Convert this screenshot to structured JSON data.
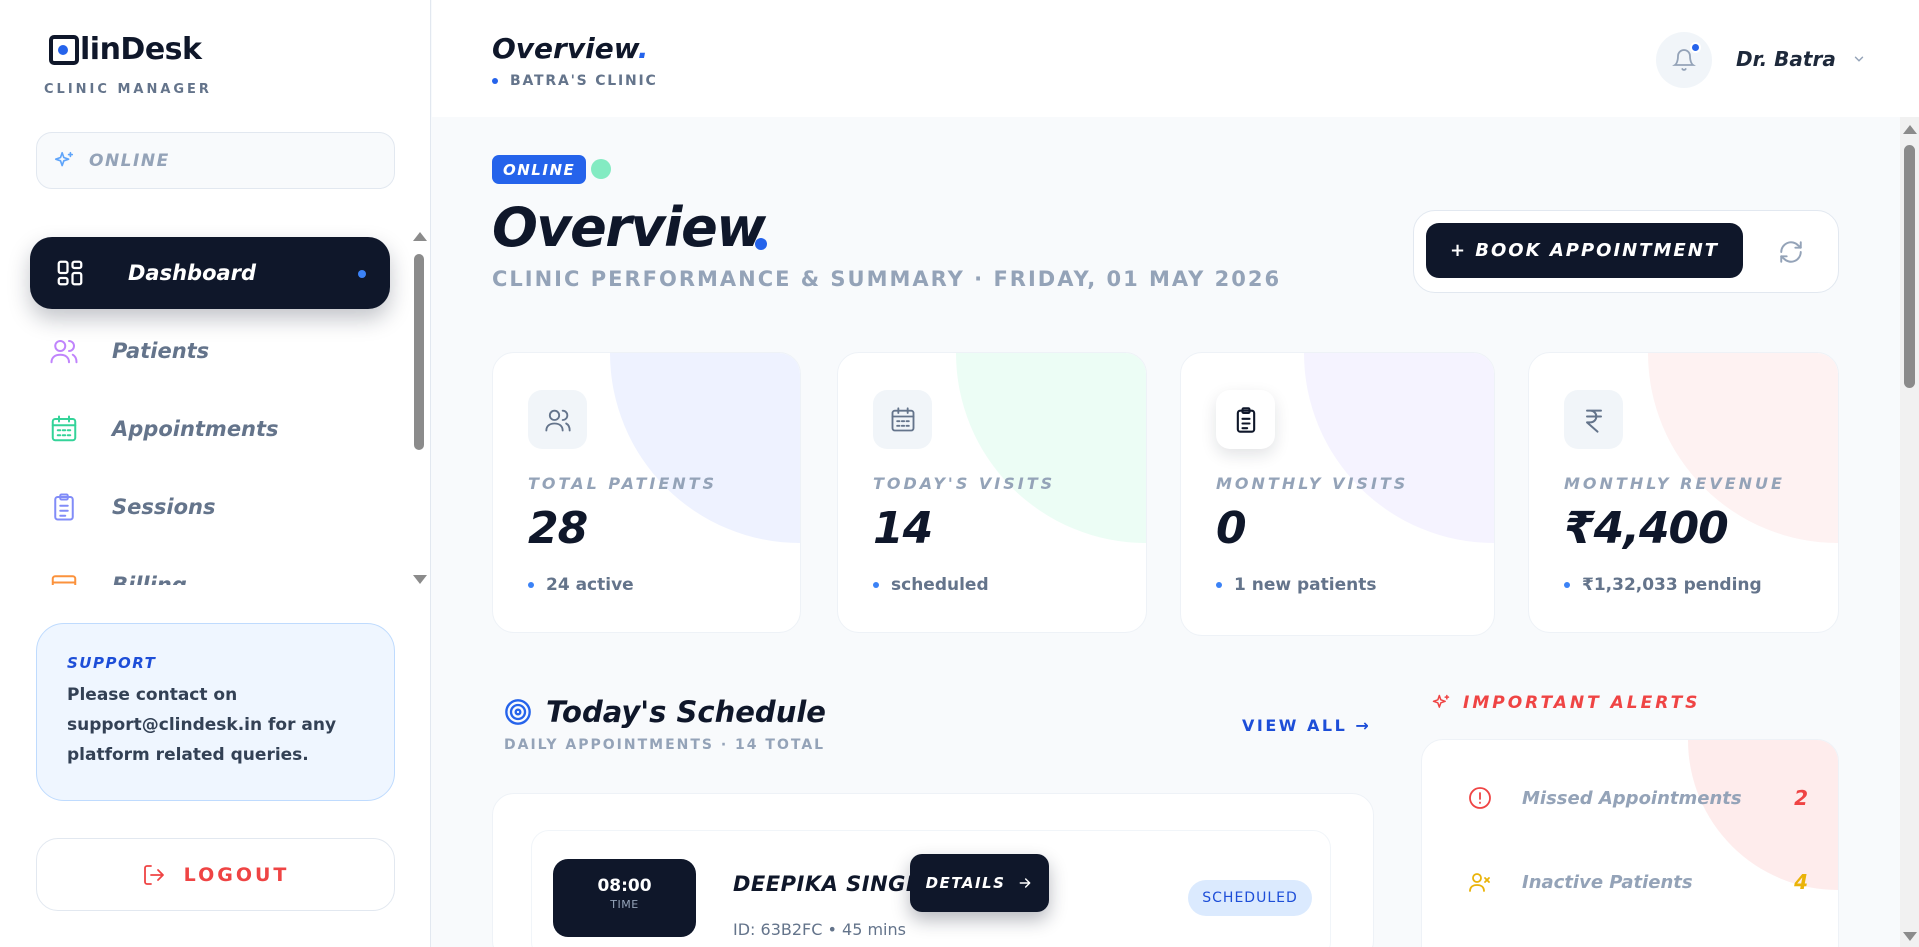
{
  "brand": {
    "lin": "linDesk",
    "sub": "CLINIC MANAGER"
  },
  "sidebar": {
    "status": "ONLINE",
    "items": [
      {
        "label": "Dashboard",
        "icon": "dashboard-icon",
        "active": true
      },
      {
        "label": "Patients",
        "icon": "users-icon"
      },
      {
        "label": "Appointments",
        "icon": "calendar-icon"
      },
      {
        "label": "Sessions",
        "icon": "clipboard-icon"
      },
      {
        "label": "Billing",
        "icon": "billing-icon"
      }
    ],
    "support": {
      "title": "SUPPORT",
      "text": "Please contact on support@clindesk.in for any platform related queries."
    },
    "logout": "LOGOUT"
  },
  "header": {
    "title": "Overview",
    "title_dot": ".",
    "clinic": "BATRA'S CLINIC",
    "user": "Dr. Batra"
  },
  "main": {
    "status_badge": "ONLINE",
    "title": "Overview",
    "subtitle": "CLINIC PERFORMANCE & SUMMARY · FRIDAY, 01 MAY 2026",
    "book_button": "+ BOOK APPOINTMENT"
  },
  "stats": [
    {
      "label": "TOTAL PATIENTS",
      "value": "28",
      "note": "24 active",
      "icon": "users-icon",
      "accent": "#eef2ff"
    },
    {
      "label": "TODAY'S VISITS",
      "value": "14",
      "note": "scheduled",
      "icon": "calendar-icon",
      "accent": "#ecfdf5"
    },
    {
      "label": "MONTHLY VISITS",
      "value": "0",
      "note": "1 new patients",
      "icon": "clipboard-icon",
      "accent": "#f5f3ff"
    },
    {
      "label": "MONTHLY REVENUE",
      "value": "₹4,400",
      "note": "₹1,32,033 pending",
      "icon": "rupee-icon",
      "accent": "#fef2f2"
    }
  ],
  "schedule": {
    "title": "Today's Schedule",
    "subtitle": "DAILY APPOINTMENTS · 14 TOTAL",
    "view_all": "VIEW ALL →",
    "appointments": [
      {
        "time": "08:00",
        "time_label": "TIME",
        "name": "DEEPIKA SINGH",
        "meta": "ID: 63B2FC • 45 mins",
        "status": "SCHEDULED",
        "details": "DETAILS"
      }
    ]
  },
  "alerts": {
    "title": "IMPORTANT ALERTS",
    "items": [
      {
        "label": "Missed Appointments",
        "count": "2",
        "color": "#ef4444"
      },
      {
        "label": "Inactive Patients",
        "count": "4",
        "color": "#eab308"
      }
    ]
  },
  "colors": {
    "primary": "#2563eb",
    "dark": "#0f172a",
    "danger": "#ef4444",
    "muted": "#94a3b8"
  }
}
